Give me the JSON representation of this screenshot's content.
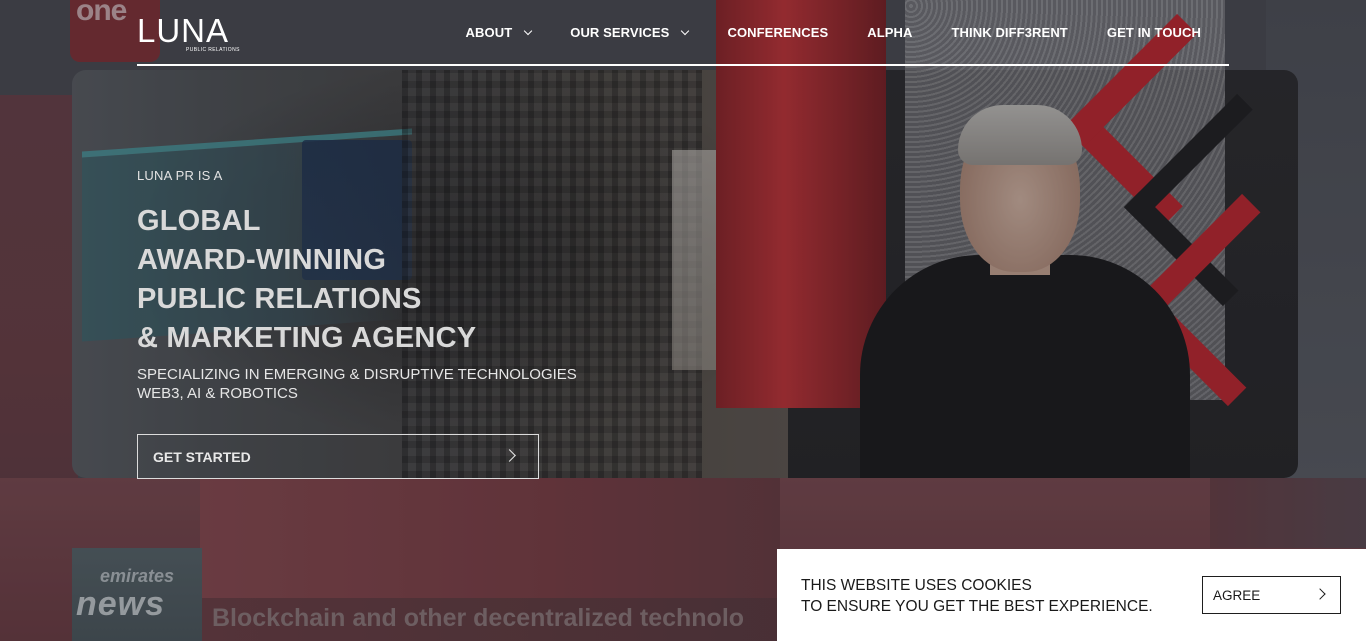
{
  "header": {
    "logo_text": "LUNA",
    "logo_sub": "PUBLIC RELATIONS",
    "nav": [
      {
        "label": "ABOUT",
        "dropdown": true
      },
      {
        "label": "OUR SERVICES",
        "dropdown": true
      },
      {
        "label": "CONFERENCES",
        "dropdown": false
      },
      {
        "label": "ALPHA",
        "dropdown": false
      },
      {
        "label": "THINK DIFF3RENT",
        "dropdown": false
      },
      {
        "label": "GET IN TOUCH",
        "dropdown": false
      }
    ]
  },
  "hero": {
    "eyebrow": "LUNA PR IS A",
    "headline": [
      "GLOBAL",
      "AWARD-WINNING",
      "PUBLIC RELATIONS",
      "& MARKETING AGENCY"
    ],
    "subtext": [
      "SPECIALIZING IN EMERGING & DISRUPTIVE TECHNOLOGIES",
      "WEB3, AI & ROBOTICS"
    ],
    "cta_label": "GET STARTED"
  },
  "background": {
    "channel_logo": "one",
    "news_brand_top": "emirates",
    "news_brand_bottom": "news",
    "ticker": "Blockchain and other decentralized technolo"
  },
  "cookie": {
    "line1": "THIS WEBSITE USES COOKIES",
    "line2": "TO ENSURE YOU GET THE BEST EXPERIENCE.",
    "agree_label": "AGREE"
  },
  "colors": {
    "accent_red": "#c1262e",
    "text_light": "#d9d9d9",
    "cookie_bg": "#ffffff"
  }
}
